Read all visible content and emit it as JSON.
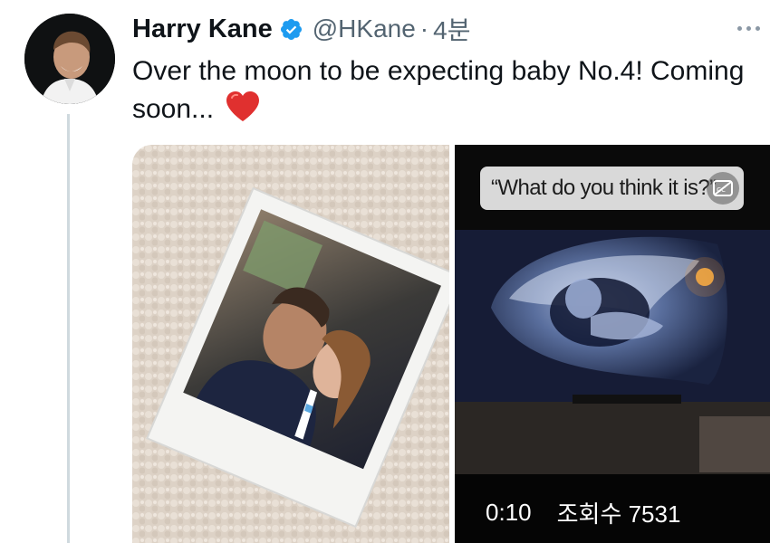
{
  "tweet": {
    "display_name": "Harry Kane",
    "handle": "@HKane",
    "separator": "·",
    "time": "4분",
    "text": "Over the moon to be expecting baby No.4! Coming soon...",
    "emoji": "heart-emoji"
  },
  "video": {
    "caption": "“What do you think it is?”",
    "duration": "0:10",
    "views": "조회수 7531"
  },
  "colors": {
    "verified_blue": "#1d9bf0",
    "secondary_text": "#536471",
    "heart_red": "#e0302f"
  }
}
